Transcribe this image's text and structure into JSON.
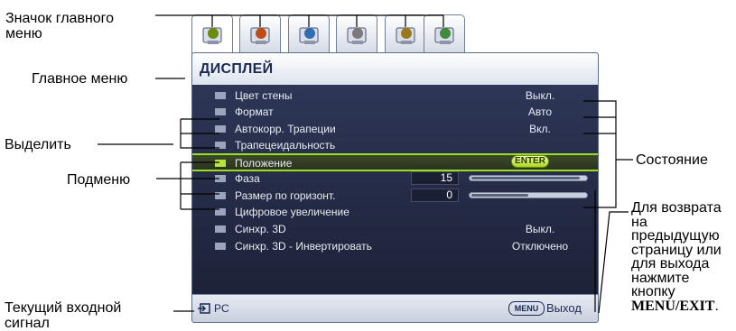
{
  "callouts": {
    "main_menu_icon": "Значок главного меню",
    "main_menu": "Главное меню",
    "highlight": "Выделить",
    "submenu": "Подменю",
    "current_input": "Текущий входной сигнал",
    "status": "Состояние",
    "return_prefix": "Для возврата на предыдущую страницу или для выхода нажмите кнопку",
    "return_key": "MENU/EXIT"
  },
  "tabs": [
    {
      "icon": "display-icon",
      "active": true
    },
    {
      "icon": "picture-icon",
      "active": false
    },
    {
      "icon": "source-icon",
      "active": false
    },
    {
      "icon": "system-setup-basic-icon",
      "active": false
    },
    {
      "icon": "system-setup-advanced-icon",
      "active": false
    },
    {
      "icon": "information-icon",
      "active": false
    }
  ],
  "osd": {
    "title": "ДИСПЛЕЙ",
    "rows": [
      {
        "icon": "wall-color-icon",
        "label": "Цвет стены",
        "value": "Выкл."
      },
      {
        "icon": "aspect-ratio-icon",
        "label": "Формат",
        "value": "Авто"
      },
      {
        "icon": "keystone-icon",
        "label": "Автокорр. Трапеции",
        "value": "Вкл."
      },
      {
        "icon": "keystone-manual-icon",
        "label": "Трапецеидальность",
        "value": ""
      },
      {
        "icon": "position-icon",
        "label": "Положение",
        "value": "",
        "badge": "ENTER"
      },
      {
        "icon": "phase-icon",
        "label": "Фаза",
        "number": "15",
        "level": 0.95
      },
      {
        "icon": "h-size-icon",
        "label": "Размер по горизонт.",
        "number": "0",
        "level": 0.5
      },
      {
        "icon": "digital-zoom-icon",
        "label": "Цифровое увеличение",
        "value": ""
      },
      {
        "icon": "sync-3d-icon",
        "label": "Синхр. 3D",
        "value": "Выкл."
      },
      {
        "icon": "sync-3d-invert-icon",
        "label": "Синхр. 3D - Инвертировать",
        "value": "Отключено"
      }
    ],
    "footer": {
      "source": "PC",
      "menu_key": "MENU",
      "exit": "Выход"
    }
  },
  "colors": {
    "highlight": "#9edc1f",
    "osd_bg": "#1e2440",
    "title_text": "#1c2a52"
  }
}
